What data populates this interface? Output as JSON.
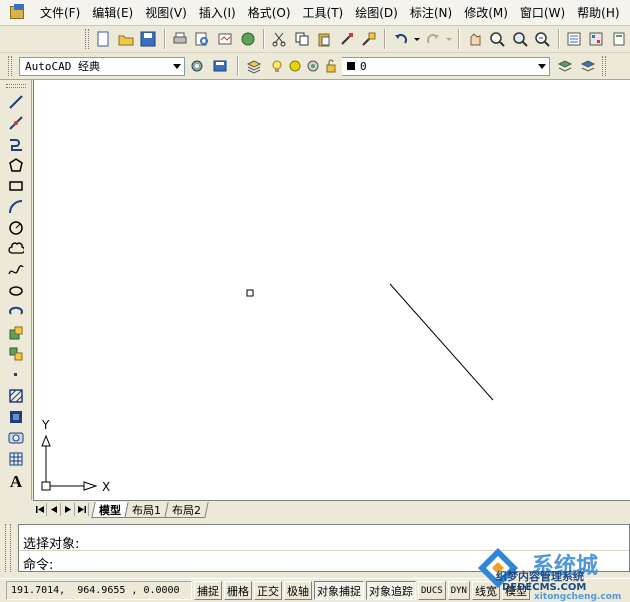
{
  "menu": {
    "items": [
      {
        "label": "文件(F)"
      },
      {
        "label": "编辑(E)"
      },
      {
        "label": "视图(V)"
      },
      {
        "label": "插入(I)"
      },
      {
        "label": "格式(O)"
      },
      {
        "label": "工具(T)"
      },
      {
        "label": "绘图(D)"
      },
      {
        "label": "标注(N)"
      },
      {
        "label": "修改(M)"
      },
      {
        "label": "窗口(W)"
      },
      {
        "label": "帮助(H)"
      }
    ]
  },
  "workspace": {
    "selected": "AutoCAD 经典"
  },
  "layer": {
    "selected": "0"
  },
  "canvas": {
    "ucs_x": "X",
    "ucs_y": "Y"
  },
  "tabs": {
    "items": [
      {
        "label": "模型"
      },
      {
        "label": "布局1"
      },
      {
        "label": "布局2"
      }
    ]
  },
  "command": {
    "history": "选择对象:",
    "prompt": "命令:"
  },
  "status": {
    "coordinates": "191.7014,  964.9655 , 0.0000",
    "toggles": [
      {
        "label": "捕捉"
      },
      {
        "label": "栅格"
      },
      {
        "label": "正交"
      },
      {
        "label": "极轴"
      },
      {
        "label": "对象捕捉"
      },
      {
        "label": "对象追踪"
      },
      {
        "label": "DUCS"
      },
      {
        "label": "DYN"
      },
      {
        "label": "线宽"
      },
      {
        "label": "模型"
      }
    ]
  },
  "watermark": {
    "text1": "系统城",
    "text2": "织梦内容管理系统",
    "text3": "DEDECMS.COM",
    "text4": "xitongcheng.com"
  },
  "colors": {
    "accent": "#3b6fc2",
    "canvas": "#ffffff",
    "chrome": "#ece9d8"
  }
}
